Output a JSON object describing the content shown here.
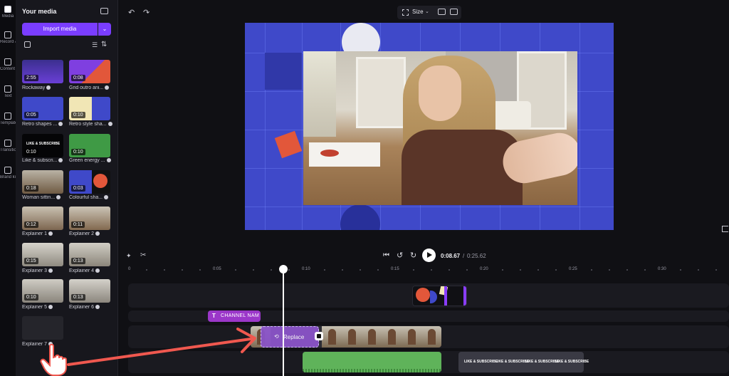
{
  "rail": {
    "items": [
      {
        "label": "Media",
        "icon": "media-icon"
      },
      {
        "label": "Record & create",
        "icon": "record-icon"
      },
      {
        "label": "Content library",
        "icon": "library-icon"
      },
      {
        "label": "Text",
        "icon": "text-icon"
      },
      {
        "label": "Templates",
        "icon": "templates-icon"
      },
      {
        "label": "Transitions",
        "icon": "transitions-icon"
      },
      {
        "label": "Brand kit",
        "icon": "brand-kit-icon"
      }
    ]
  },
  "media_panel": {
    "title": "Your media",
    "import_label": "Import media",
    "import_dropdown": "⌄",
    "items": [
      {
        "name": "Rockaway",
        "duration": "2:55"
      },
      {
        "name": "Grid outro ani...",
        "duration": "0:08"
      },
      {
        "name": "Retro shapes ...",
        "duration": "0:05"
      },
      {
        "name": "Retro style sha...",
        "duration": "0:10"
      },
      {
        "name": "Like & subscri...",
        "duration": "0:10",
        "thumb_text": "LIKE & SUBSCRIBE"
      },
      {
        "name": "Green energy ...",
        "duration": "0:10"
      },
      {
        "name": "Woman sittin...",
        "duration": "0:18"
      },
      {
        "name": "Colourful sha...",
        "duration": "0:03"
      },
      {
        "name": "Explainer 1",
        "duration": "0:12"
      },
      {
        "name": "Explainer 2",
        "duration": "0:11"
      },
      {
        "name": "Explainer 3",
        "duration": "0:15"
      },
      {
        "name": "Explainer 4",
        "duration": "0:13"
      },
      {
        "name": "Explainer 5",
        "duration": "0:10"
      },
      {
        "name": "Explainer 6",
        "duration": "0:13"
      },
      {
        "name": "Explainer 7",
        "duration": ""
      }
    ]
  },
  "toolbar": {
    "undo": "↶",
    "redo": "↷",
    "size_label": "Size",
    "size_caret": "⌄"
  },
  "playback": {
    "current_time": "0:08.67",
    "separator": "/",
    "total_time": "0:25.62",
    "skip_back": "⏮",
    "rewind": "↺",
    "forward": "↻"
  },
  "timeline": {
    "ticks": [
      "0",
      "0:05",
      "0:10",
      "0:15",
      "0:20",
      "0:25",
      "0:30"
    ],
    "text_clip_label": "CHANNEL NAM",
    "text_clip_icon": "T",
    "replace_label": "Replace",
    "replace_icon": "⟲",
    "subscribe_labels": [
      "LIKE & SUBSCRIBE",
      "LIKE & SUBSCRIBE",
      "LIKE & SUBSCRIBE",
      "LIKE & SUBSCRIBE"
    ]
  },
  "colors": {
    "accent": "#7a3dff",
    "preview_bg": "#3f49c9",
    "text_clip": "#9b37c9",
    "audio_clip": "#5fb35a",
    "annotation_arrow": "#f0584f"
  }
}
